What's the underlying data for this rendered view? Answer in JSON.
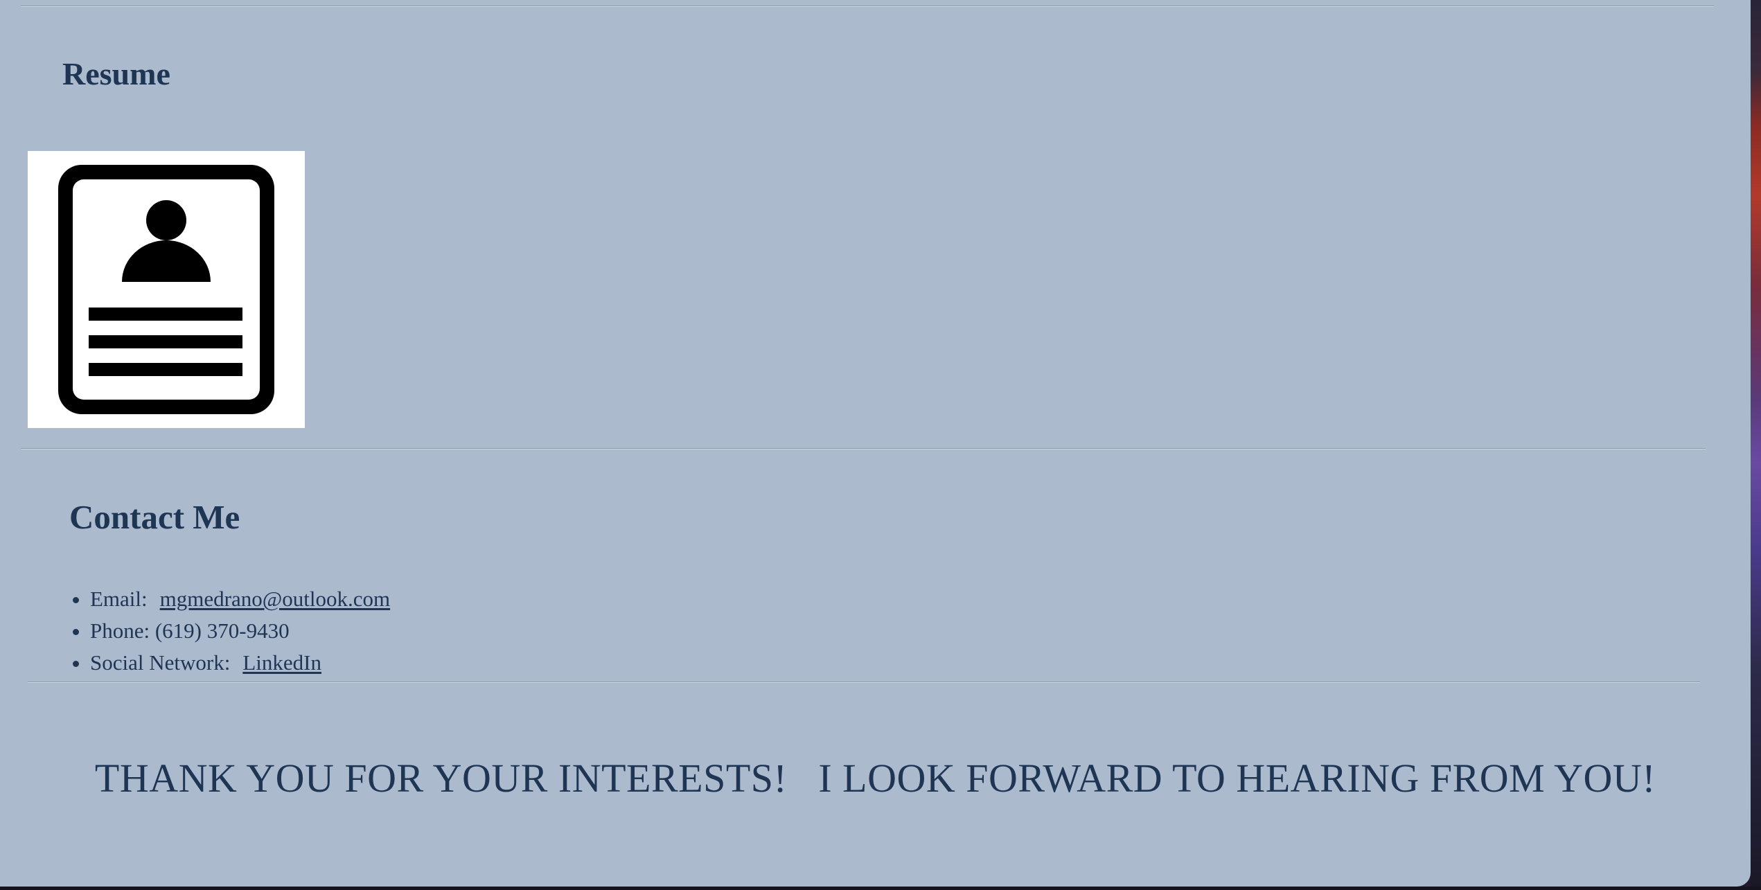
{
  "resume": {
    "heading": "Resume",
    "image_icon": "resume-document-icon"
  },
  "contact": {
    "heading": "Contact Me",
    "email_label": "Email:",
    "email_value": "mgmedrano@outlook.com",
    "phone_text": "Phone: (619) 370-9430",
    "social_label": "Social Network:",
    "social_link": "LinkedIn"
  },
  "closing": {
    "message": "THANK YOU FOR YOUR INTERESTS!   I LOOK FORWARD TO HEARING FROM YOU!"
  },
  "colors": {
    "page_background": "#acbace",
    "text": "#1e3554"
  }
}
